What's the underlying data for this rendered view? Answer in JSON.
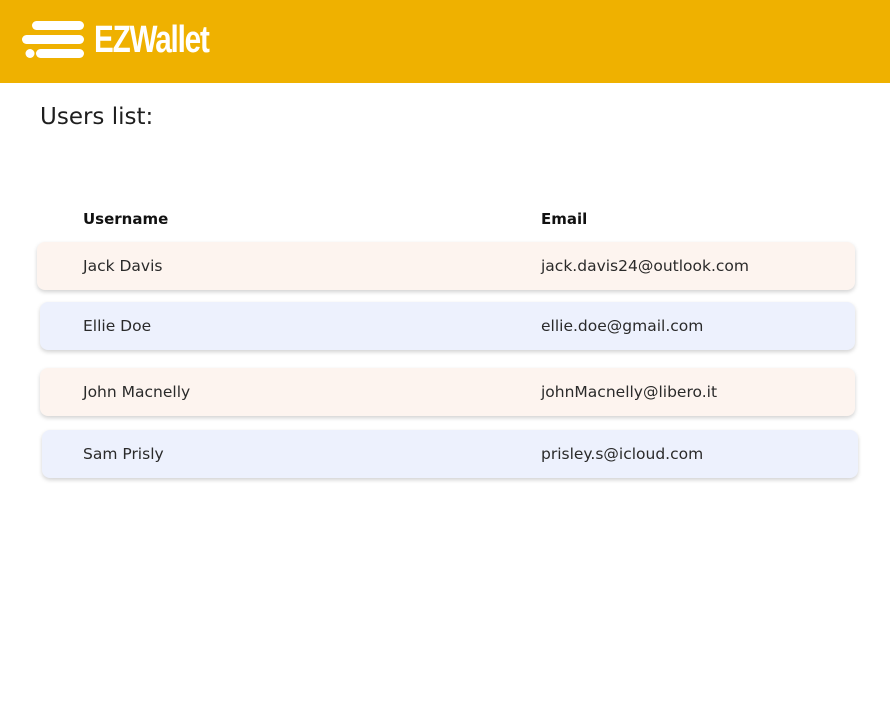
{
  "brand": {
    "name": "EZWallet",
    "logo_icon": "speed-lines-icon",
    "bar_color": "#efb100"
  },
  "page": {
    "heading": "Users list:"
  },
  "table": {
    "columns": [
      "Username",
      "Email"
    ],
    "rows": [
      {
        "username": "Jack Davis",
        "email": "jack.davis24@outlook.com",
        "tint": "#fdf4ef"
      },
      {
        "username": "Ellie Doe",
        "email": "ellie.doe@gmail.com",
        "tint": "#edf1fd"
      },
      {
        "username": "John Macnelly",
        "email": "johnMacnelly@libero.it",
        "tint": "#fdf4ef"
      },
      {
        "username": "Sam Prisly",
        "email": "prisley.s@icloud.com",
        "tint": "#edf1fd"
      }
    ]
  }
}
